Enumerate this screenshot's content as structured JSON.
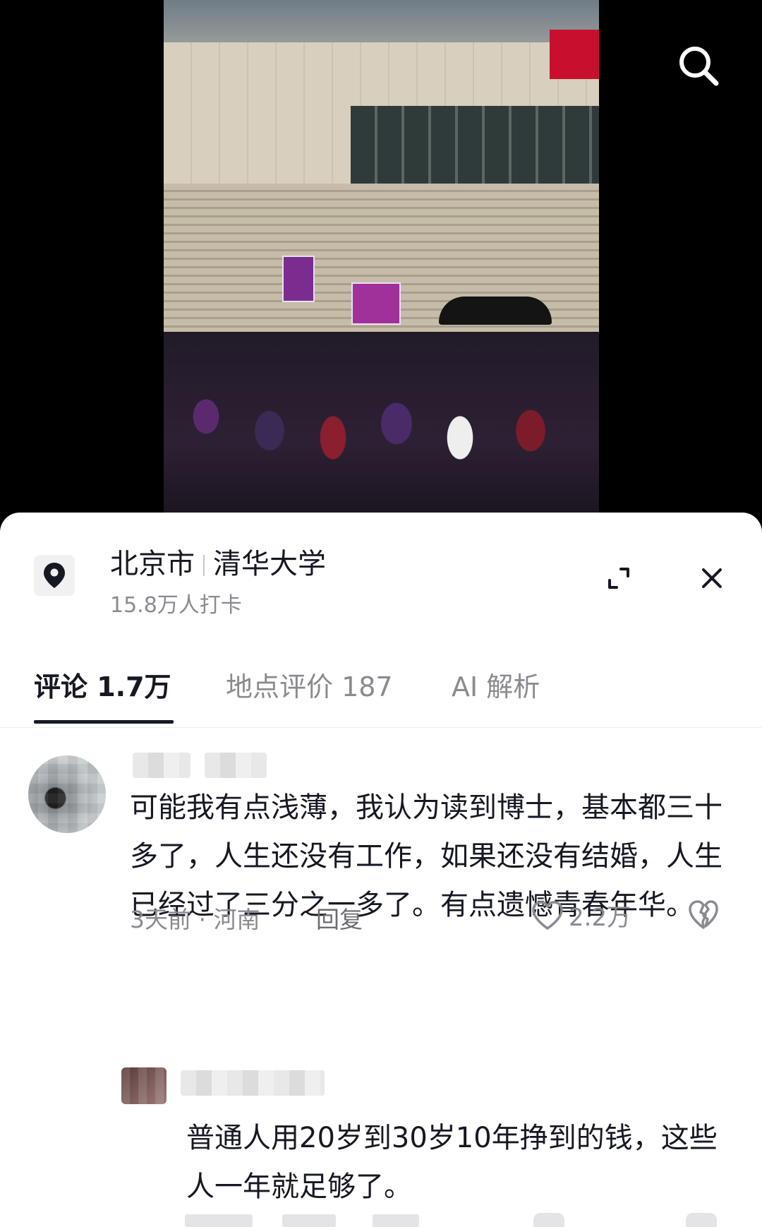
{
  "location": {
    "city": "北京市",
    "place": "清华大学",
    "checkins": "15.8万人打卡"
  },
  "tabs": [
    {
      "label": "评论 1.7万",
      "active": true
    },
    {
      "label": "地点评价 187",
      "active": false
    },
    {
      "label": "AI 解析",
      "active": false
    }
  ],
  "comments": [
    {
      "text": "可能我有点浅薄，我认为读到博士，基本都三十多了，人生还没有工作，如果还没有结婚，人生已经过了三分之一多了。有点遗憾青春年华。",
      "time": "3天前",
      "region": "河南",
      "reply_label": "回复",
      "likes": "2.2万"
    },
    {
      "text": "普通人用20岁到30岁10年挣到的钱，这些人一年就足够了。"
    }
  ],
  "icons": {
    "search": "search-icon",
    "location": "location-pin-icon",
    "expand": "expand-icon",
    "close": "close-icon",
    "like": "heart-icon",
    "dislike": "broken-heart-icon"
  },
  "colors": {
    "text_primary": "#161823",
    "text_secondary": "#8a8b91",
    "panel_bg": "#ffffff",
    "video_bg": "#000000"
  }
}
